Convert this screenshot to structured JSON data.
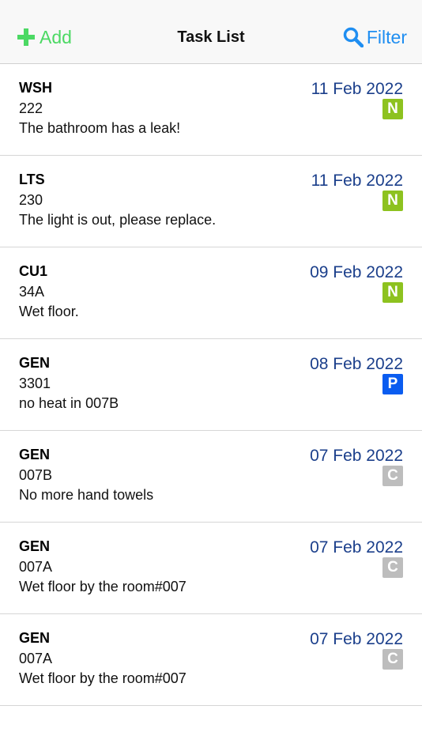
{
  "navbar": {
    "add_label": "Add",
    "title": "Task List",
    "filter_label": "Filter",
    "add_color": "#4cd964",
    "filter_color": "#1f8ef1"
  },
  "status_colors": {
    "N": "#8dc21f",
    "P": "#0a5cf0",
    "C": "#bdbdbd"
  },
  "tasks": [
    {
      "code": "WSH",
      "room": "222",
      "description": "The bathroom has a leak!",
      "date": "11 Feb 2022",
      "status": "N"
    },
    {
      "code": "LTS",
      "room": "230",
      "description": "The light is out, please replace.",
      "date": "11 Feb 2022",
      "status": "N"
    },
    {
      "code": "CU1",
      "room": "34A",
      "description": "Wet floor.",
      "date": "09 Feb 2022",
      "status": "N"
    },
    {
      "code": "GEN",
      "room": "3301",
      "description": "no heat in 007B",
      "date": "08 Feb 2022",
      "status": "P"
    },
    {
      "code": "GEN",
      "room": "007B",
      "description": "No more hand towels",
      "date": "07 Feb 2022",
      "status": "C"
    },
    {
      "code": "GEN",
      "room": "007A",
      "description": "Wet floor by the room#007",
      "date": "07 Feb 2022",
      "status": "C"
    },
    {
      "code": "GEN",
      "room": "007A",
      "description": "Wet floor by the room#007",
      "date": "07 Feb 2022",
      "status": "C"
    }
  ]
}
